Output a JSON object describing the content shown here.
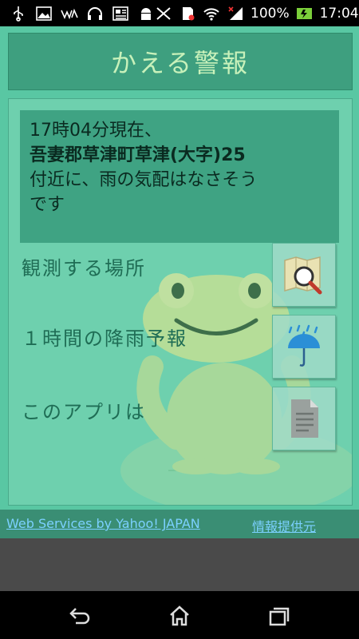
{
  "status_bar": {
    "battery_percent": "100%",
    "time": "17:04"
  },
  "app": {
    "title": "かえる警報",
    "info": {
      "line1": "17時04分現在、",
      "address": "吾妻郡草津町草津(大字)25",
      "line3": "付近に、雨の気配はなさそう",
      "line4": "です"
    },
    "menu": {
      "location_label": "観測する場所",
      "forecast_label": "１時間の降雨予報",
      "about_label": "このアプリは"
    },
    "footer": {
      "credit_link": "Web Services by Yahoo! JAPAN",
      "provider_link": "情報提供元"
    }
  },
  "icons": {
    "map": "map-search-icon",
    "rain": "umbrella-rain-icon",
    "document": "document-icon"
  },
  "colors": {
    "background": "#59c7a3",
    "title_bar": "#3e9f7f",
    "title_text": "#c8f1ba",
    "info_box": "#3fa383",
    "footer": "#3a8e74",
    "link": "#7bd0ff"
  }
}
